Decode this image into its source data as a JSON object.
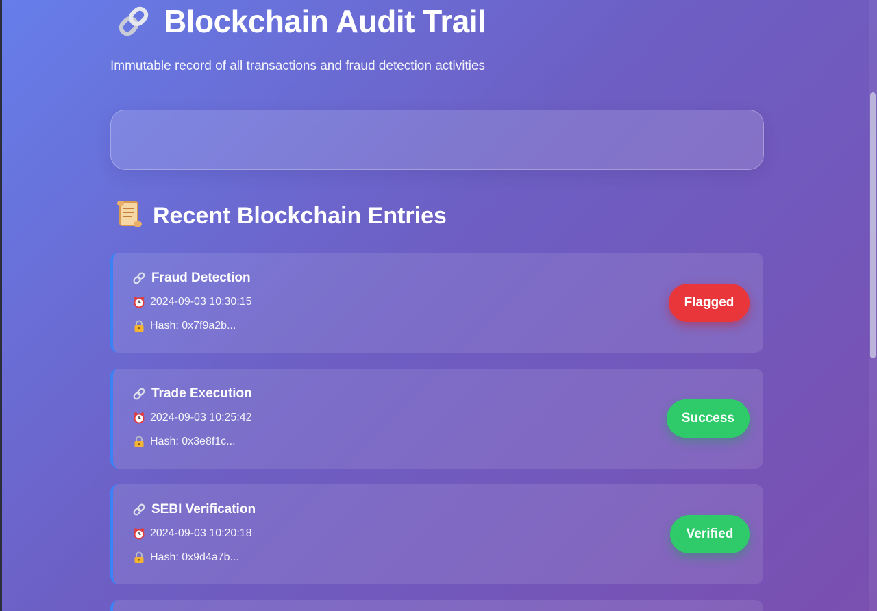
{
  "header": {
    "title": "Blockchain Audit Trail",
    "title_icon": "link-icon",
    "subtitle": "Immutable record of all transactions and fraud detection activities"
  },
  "section": {
    "title": "Recent Blockchain Entries",
    "icon": "scroll-icon"
  },
  "entries": [
    {
      "type": "Fraud Detection",
      "timestamp": "2024-09-03 10:30:15",
      "hash": "Hash: 0x7f9a2b...",
      "status": "Flagged",
      "status_color": "#e8363a"
    },
    {
      "type": "Trade Execution",
      "timestamp": "2024-09-03 10:25:42",
      "hash": "Hash: 0x3e8f1c...",
      "status": "Success",
      "status_color": "#2fcb6a"
    },
    {
      "type": "SEBI Verification",
      "timestamp": "2024-09-03 10:20:18",
      "hash": "Hash: 0x9d4a7b...",
      "status": "Verified",
      "status_color": "#2fcb6a"
    }
  ],
  "colors": {
    "background_start": "#667eea",
    "background_end": "#7a4fb0",
    "card_accent": "#3b82f6"
  }
}
